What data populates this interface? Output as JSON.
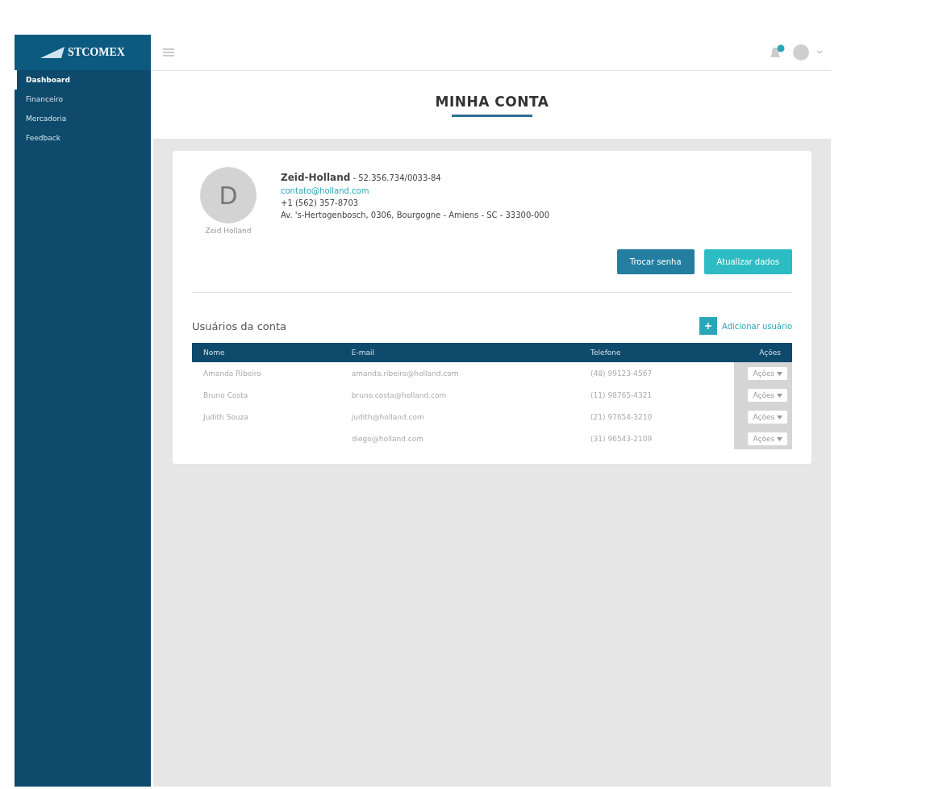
{
  "brand": "STCOMEX",
  "sidebar": {
    "items": [
      {
        "label": "Dashboard",
        "selected": true
      },
      {
        "label": "Financeiro",
        "selected": false
      },
      {
        "label": "Mercadoria",
        "selected": false
      },
      {
        "label": "Feedback",
        "selected": false
      }
    ]
  },
  "header": {
    "notification": true
  },
  "page_title": "MINHA CONTA",
  "account": {
    "avatar_letter": "D",
    "avatar_caption": "Zeid Holland",
    "name": "Zeid-Holland",
    "document": "- 52.356.734/0033-84",
    "email": "contato@holland.com",
    "phone": "+1 (562) 357-8703",
    "address": "Av. 's-Hertogenbosch, 0306, Bourgogne - Amiens - SC - 33300-000"
  },
  "buttons": [
    {
      "label": "Trocar senha",
      "kind": "dark"
    },
    {
      "label": "Atualizar dados",
      "kind": "light"
    }
  ],
  "users": {
    "title": "Usuários da conta",
    "add_label": "Adicionar usuário",
    "columns": [
      "Nome",
      "E-mail",
      "Telefone",
      "Ações"
    ],
    "rows": [
      {
        "cells": [
          "Amanda Ribeiro",
          "amanda.ribeiro@holland.com",
          "(48) 99123-4567"
        ],
        "action": "Ações"
      },
      {
        "cells": [
          "Bruno Costa",
          "bruno.costa@holland.com",
          "(11) 98765-4321"
        ],
        "action": "Ações"
      },
      {
        "cells": [
          "Judith Souza",
          "judith@holland.com",
          "(21) 97654-3210"
        ],
        "action": "Ações"
      },
      {
        "cells": [
          "",
          "diego@holland.com",
          "(31) 96543-2109"
        ],
        "action": "Ações"
      }
    ]
  }
}
